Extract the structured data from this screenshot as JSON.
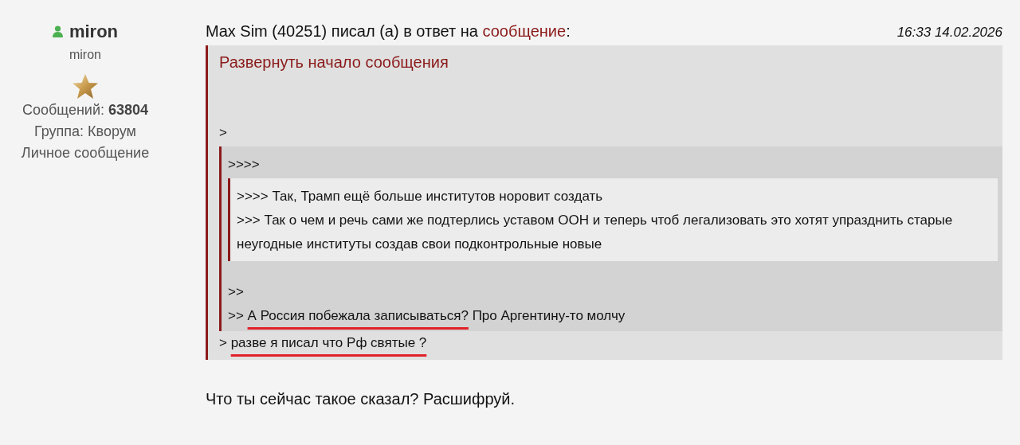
{
  "author": {
    "name": "miron",
    "online": true,
    "title": "miron",
    "posts_label": "Сообщений:",
    "posts": "63804",
    "group": "Группа: Кворум",
    "pm_link": "Личное сообщение"
  },
  "post": {
    "header": {
      "prefix": "Max Sim (40251) писал (а) в ответ на ",
      "link": "сообщение",
      "suffix": ":"
    },
    "time": "16:33 14.02.2026",
    "quote": {
      "expand_link": "Развернуть начало сообщения",
      "content": [
        {
          "kind": "line",
          "text": ">"
        },
        {
          "kind": "quote",
          "content": [
            {
              "kind": "line",
              "text": ">>>>"
            },
            {
              "kind": "quote",
              "content": [
                {
                  "kind": "line",
                  "text": ">>>> Так, Трамп ещё больше институтов норовит создать"
                },
                {
                  "kind": "line",
                  "text": ">>> Так о чем и речь сами же подтерлись уставом ООН и теперь чтоб легализовать это хотят упразднить старые неугодные институты создав свои подконтрольные новые"
                }
              ]
            },
            {
              "kind": "gap"
            },
            {
              "kind": "line",
              "text": ">>"
            },
            {
              "kind": "line",
              "text": ">> ",
              "underlined": "А Россия побежала записываться?",
              "after": " Про Аргентину-то молчу"
            }
          ]
        },
        {
          "kind": "line",
          "text": "> ",
          "underlined": "разве я писал что Рф святые ?"
        }
      ]
    },
    "reply": "Что ты сейчас такое сказал? Расшифруй."
  }
}
